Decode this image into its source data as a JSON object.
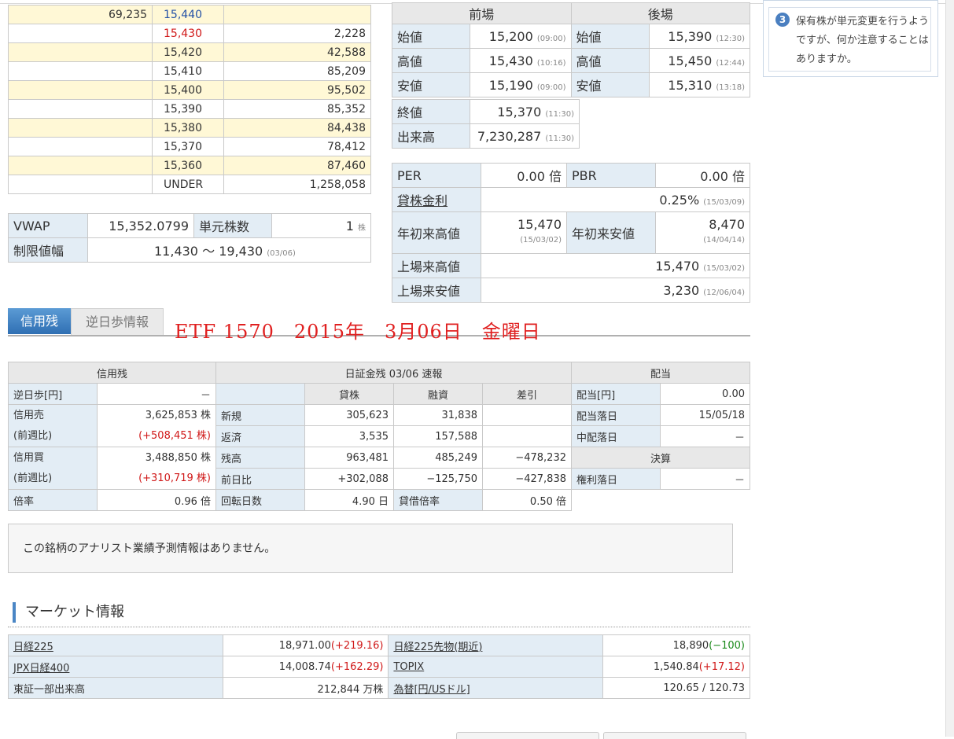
{
  "board": {
    "rows": [
      {
        "sell": "69,235",
        "price": "15,440",
        "buy": "",
        "price_color": "blue",
        "yellow": true
      },
      {
        "sell": "",
        "price": "15,430",
        "buy": "2,228",
        "price_color": "red",
        "yellow": false
      },
      {
        "sell": "",
        "price": "15,420",
        "buy": "42,588",
        "price_color": "",
        "yellow": true
      },
      {
        "sell": "",
        "price": "15,410",
        "buy": "85,209",
        "price_color": "",
        "yellow": false
      },
      {
        "sell": "",
        "price": "15,400",
        "buy": "95,502",
        "price_color": "",
        "yellow": true
      },
      {
        "sell": "",
        "price": "15,390",
        "buy": "85,352",
        "price_color": "",
        "yellow": false
      },
      {
        "sell": "",
        "price": "15,380",
        "buy": "84,438",
        "price_color": "",
        "yellow": true
      },
      {
        "sell": "",
        "price": "15,370",
        "buy": "78,412",
        "price_color": "",
        "yellow": false
      },
      {
        "sell": "",
        "price": "15,360",
        "buy": "87,460",
        "price_color": "",
        "yellow": true
      },
      {
        "sell": "",
        "price": "UNDER",
        "buy": "1,258,058",
        "price_color": "",
        "yellow": false
      }
    ]
  },
  "vwap": {
    "vwap_label": "VWAP",
    "vwap_value": "15,352.0799",
    "unit_label": "単元株数",
    "unit_value": "1",
    "unit_suffix": "株",
    "limit_label": "制限値幅",
    "limit_low": "11,430",
    "limit_sep": "〜",
    "limit_high": "19,430",
    "limit_date": "(03/06)"
  },
  "session": {
    "am_header": "前場",
    "pm_header": "後場",
    "rows": [
      {
        "am_label": "始値",
        "am_value": "15,200",
        "am_time": "(09:00)",
        "pm_label": "始値",
        "pm_value": "15,390",
        "pm_time": "(12:30)"
      },
      {
        "am_label": "高値",
        "am_value": "15,430",
        "am_time": "(10:16)",
        "pm_label": "高値",
        "pm_value": "15,450",
        "pm_time": "(12:44)"
      },
      {
        "am_label": "安値",
        "am_value": "15,190",
        "am_time": "(09:00)",
        "pm_label": "安値",
        "pm_value": "15,310",
        "pm_time": "(13:18)"
      }
    ],
    "close_label": "終値",
    "close_value": "15,370",
    "close_time": "(11:30)",
    "volume_label": "出来高",
    "volume_value": "7,230,287",
    "volume_time": "(11:30)"
  },
  "indicators": {
    "per_label": "PER",
    "per_value": "0.00",
    "per_unit": "倍",
    "pbr_label": "PBR",
    "pbr_value": "0.00",
    "pbr_unit": "倍",
    "lending_label": "貸株金利",
    "lending_value": "0.25%",
    "lending_date": "(15/03/09)",
    "ytd_high_label": "年初来高値",
    "ytd_high_value": "15,470",
    "ytd_high_date": "(15/03/02)",
    "ytd_low_label": "年初来安値",
    "ytd_low_value": "8,470",
    "ytd_low_date": "(14/04/14)",
    "listed_high_label": "上場来高値",
    "listed_high_value": "15,470",
    "listed_high_date": "(15/03/02)",
    "listed_low_label": "上場来安値",
    "listed_low_value": "3,230",
    "listed_low_date": "(12/06/04)"
  },
  "tabs": {
    "active": "信用残",
    "inactive": "逆日歩情報"
  },
  "overlay_text": "ETF 1570　2015年　3月06日　金曜日",
  "margin": {
    "credit_header": "信用残",
    "nissho_header": "日証金残 03/06 速報",
    "dividend_header": "配当",
    "reverse_label": "逆日歩[円]",
    "reverse_value": "－",
    "col_lend": "貸株",
    "col_loan": "融資",
    "col_diff": "差引",
    "sell_label": "信用売",
    "sell_sub": "(前週比)",
    "sell_value": "3,625,853 株",
    "sell_change": "(+508,451 株)",
    "buy_label": "信用買",
    "buy_sub": "(前週比)",
    "buy_value": "3,488,850 株",
    "buy_change": "(+310,719 株)",
    "ratio_label": "倍率",
    "ratio_value": "0.96 倍",
    "rows": [
      {
        "label": "新規",
        "lend": "305,623",
        "loan": "31,838",
        "diff": ""
      },
      {
        "label": "返済",
        "lend": "3,535",
        "loan": "157,588",
        "diff": ""
      },
      {
        "label": "残高",
        "lend": "963,481",
        "loan": "485,249",
        "diff": "−478,232"
      },
      {
        "label": "前日比",
        "lend": "+302,088",
        "loan": "−125,750",
        "diff": "−427,838"
      }
    ],
    "turnover_label": "回転日数",
    "turnover_value": "4.90 日",
    "lendratio_label": "貸借倍率",
    "lendratio_value": "0.50 倍",
    "div_label": "配当[円]",
    "div_value": "0.00",
    "exdate_label": "配当落日",
    "exdate_value": "15/05/18",
    "midex_label": "中配落日",
    "midex_value": "－",
    "settle_header": "決算",
    "rights_label": "権利落日",
    "rights_value": "－"
  },
  "analyst_text": "この銘柄のアナリスト業績予測情報はありません。",
  "market": {
    "title": "マーケット情報",
    "rows": [
      {
        "l_label": "日経225",
        "l_value": "18,971.00",
        "l_change": "(+219.16)",
        "l_color": "red",
        "r_label": "日経225先物(期近)",
        "r_value": "18,890",
        "r_change": "(−100)",
        "r_color": "green"
      },
      {
        "l_label": "JPX日経400",
        "l_value": "14,008.74",
        "l_change": "(+162.29)",
        "l_color": "red",
        "r_label": "TOPIX",
        "r_value": "1,540.84",
        "r_change": "(+17.12)",
        "r_color": "red"
      },
      {
        "l_label": "東証一部出来高",
        "l_value": "212,844 万株",
        "l_change": "",
        "l_color": "",
        "r_label": "為替[円/USドル]",
        "r_value": "120.65 / 120.73",
        "r_change": "",
        "r_color": ""
      }
    ]
  },
  "tip": {
    "badge": "3",
    "text": "保有株が単元変更を行うようですが、何か注意することはありますか。"
  }
}
